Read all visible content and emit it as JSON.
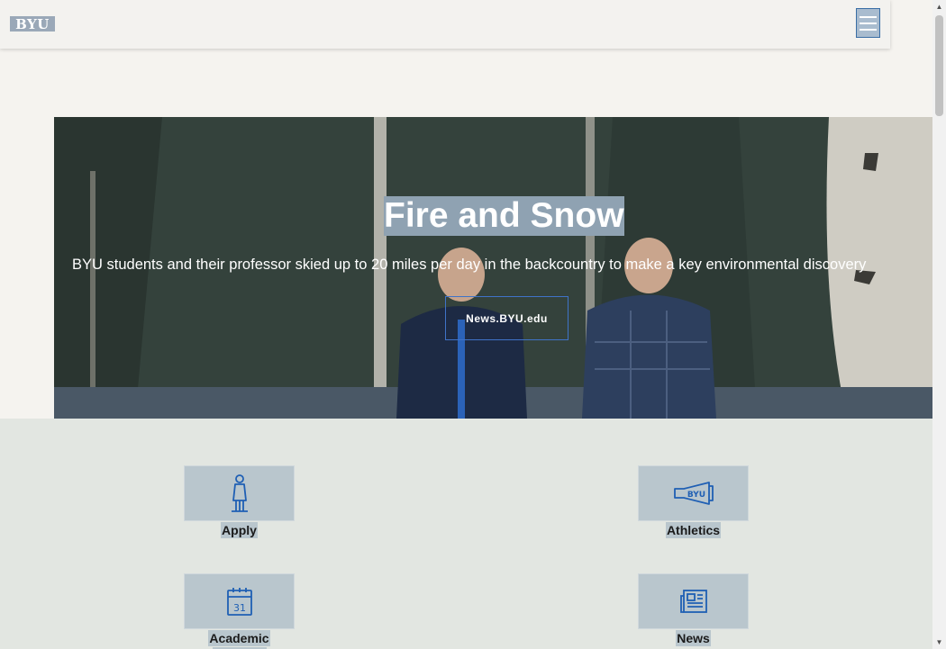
{
  "header": {
    "logo_text": "BYU",
    "menu_icon": "hamburger-menu-icon"
  },
  "hero": {
    "title": "Fire and Snow",
    "subtitle": "BYU students and their professor skied up to 20 miles per day in the backcountry to make a key environmental discovery",
    "button_label": "News.BYU.edu"
  },
  "quick_links": [
    {
      "label": "Apply",
      "icon": "graduate-statue-icon"
    },
    {
      "label": "Athletics",
      "icon": "megaphone-icon"
    },
    {
      "label": "Academic",
      "icon": "calendar-icon",
      "calendar_day": "31"
    },
    {
      "label": "News",
      "icon": "newspaper-icon"
    }
  ],
  "colors": {
    "accent": "#3a6ea5",
    "icon_blue": "#1f5fb4",
    "tile_bg": "#b9c6cd"
  }
}
